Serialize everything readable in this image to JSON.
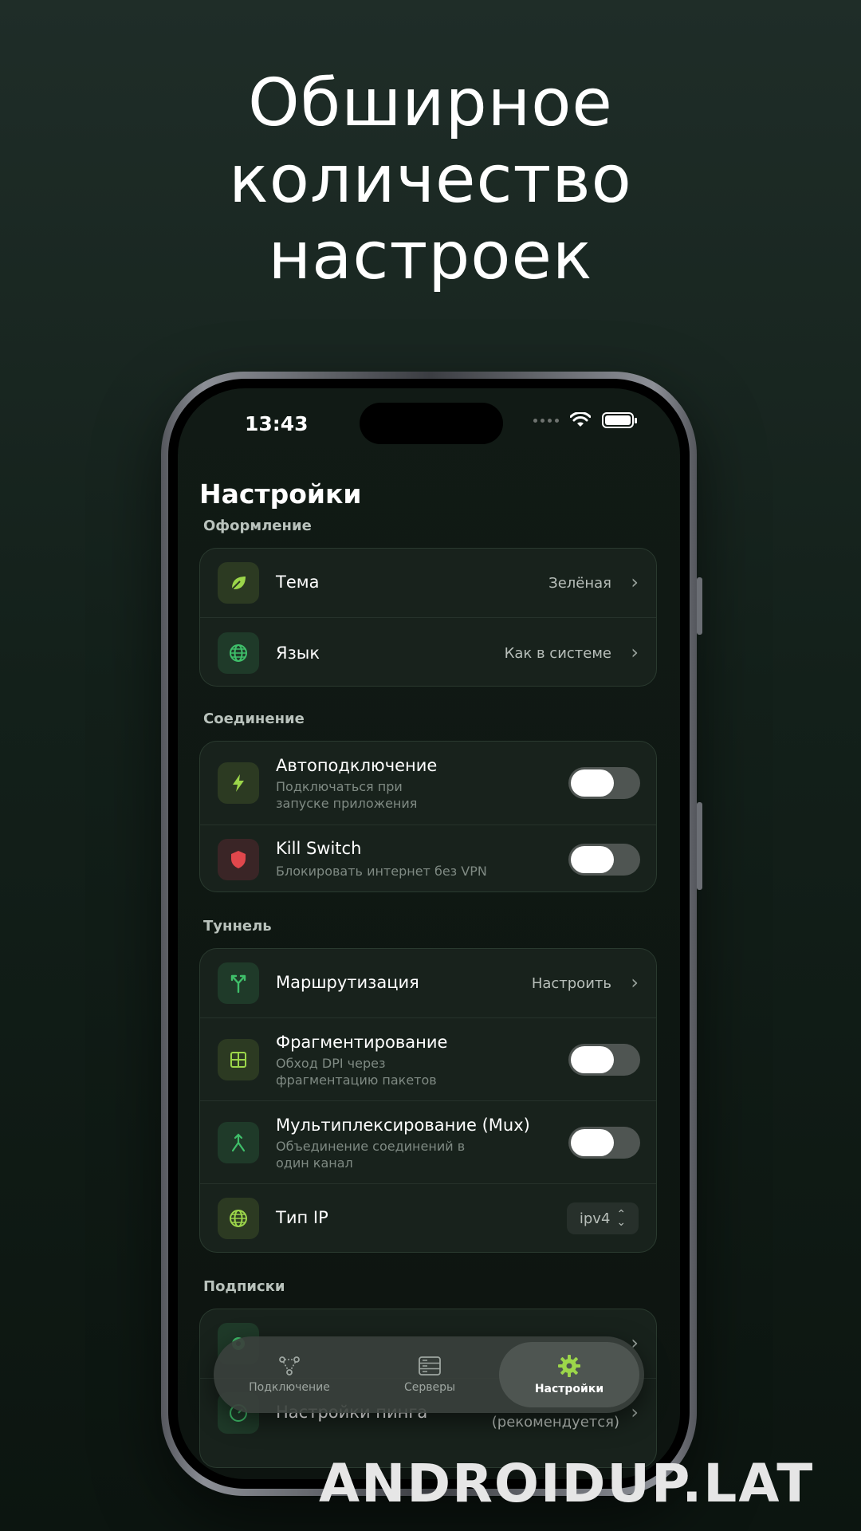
{
  "headline": [
    "Обширное",
    "количество",
    "настроек"
  ],
  "status_bar": {
    "time": "13:43"
  },
  "page_title": "Настройки",
  "sections": {
    "appearance": {
      "title": "Оформление",
      "rows": [
        {
          "title": "Тема",
          "value": "Зелёная",
          "icon": "leaf-icon"
        },
        {
          "title": "Язык",
          "value": "Как в системе",
          "icon": "globe-icon"
        }
      ]
    },
    "connection": {
      "title": "Соединение",
      "rows": [
        {
          "title": "Автоподключение",
          "subtitle_line1": "Подключаться при",
          "subtitle_line2": "запуске приложения",
          "enabled": false,
          "icon": "bolt-icon"
        },
        {
          "title": "Kill Switch",
          "subtitle_line1": "Блокировать интернет без VPN",
          "enabled": false,
          "icon": "shield-icon"
        }
      ]
    },
    "tunnel": {
      "title": "Туннель",
      "rows": [
        {
          "title": "Маршрутизация",
          "value": "Настроить",
          "icon": "routing-icon"
        },
        {
          "title": "Фрагментирование",
          "subtitle_line1": "Обход DPI через",
          "subtitle_line2": "фрагментацию пакетов",
          "enabled": false,
          "icon": "grid-icon"
        },
        {
          "title": "Мультиплексирование (Mux)",
          "subtitle_line1": "Объединение соединений в",
          "subtitle_line2": "один канал",
          "enabled": false,
          "icon": "merge-icon"
        },
        {
          "title": "Тип IP",
          "value": "ipv4",
          "icon": "globe-icon"
        }
      ]
    },
    "subscriptions": {
      "title": "Подписки",
      "rows": [
        {
          "title": "",
          "icon": "gear-icon"
        },
        {
          "title": "Настройки пинга",
          "value": "(рекомендуется)",
          "icon": "gauge-icon"
        }
      ]
    }
  },
  "tabbar": {
    "tabs": [
      {
        "label": "Подключение",
        "icon": "network-icon",
        "active": false
      },
      {
        "label": "Серверы",
        "icon": "server-icon",
        "active": false
      },
      {
        "label": "Настройки",
        "icon": "gear-icon",
        "active": true
      }
    ]
  },
  "watermark": "ANDROIDUP.LAT",
  "colors": {
    "accent": "#9cd64a",
    "background": "#13201a",
    "card": "#18221c",
    "danger": "#e0474c"
  }
}
